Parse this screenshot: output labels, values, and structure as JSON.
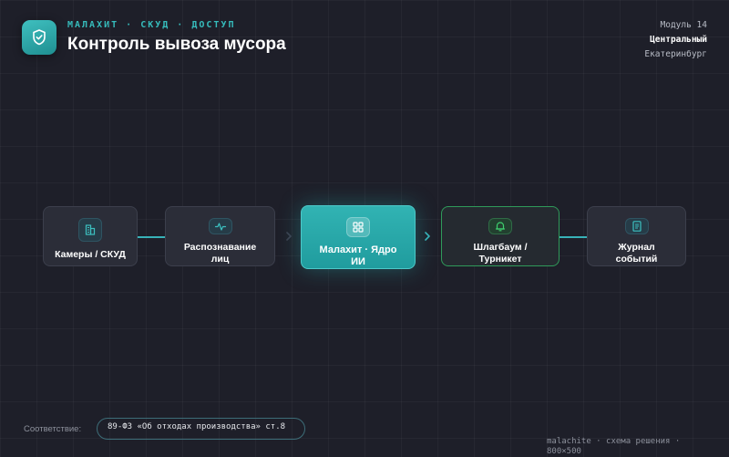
{
  "header": {
    "eyebrow": "МАЛАХИТ · СКУД · ДОСТУП",
    "title": "Контроль вывоза мусора",
    "logo_icon": "shield-check-icon"
  },
  "meta": {
    "module": "Модуль 14",
    "district": "Центральный",
    "city": "Екатеринбург"
  },
  "flow": {
    "nodes": [
      {
        "label": "Камеры / СКУД",
        "icon": "building-icon"
      },
      {
        "label": "Распознавание лиц",
        "icon": "pulse-icon"
      },
      {
        "label": "Малахит · Ядро ИИ",
        "icon": "grid-icon"
      },
      {
        "label": "Шлагбаум / Турникет",
        "icon": "bell-icon"
      },
      {
        "label": "Журнал событий",
        "icon": "document-icon"
      }
    ]
  },
  "colors": {
    "accent": "#31b3b3",
    "connector": "#38b2b8",
    "gate_border": "#2f9a5a",
    "background": "#1e1f29"
  },
  "compliance": {
    "label": "Соответствие:",
    "value": "89-ФЗ «Об отходах производства» ст.8"
  },
  "footer": {
    "text": "malachite · схема решения · 800×500"
  }
}
